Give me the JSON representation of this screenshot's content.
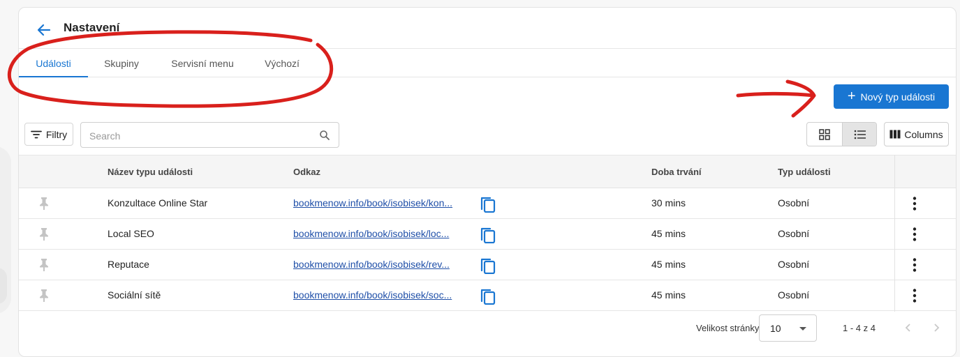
{
  "header": {
    "title": "Nastavení"
  },
  "tabs": [
    {
      "label": "Události",
      "active": true
    },
    {
      "label": "Skupiny",
      "active": false
    },
    {
      "label": "Servisní menu",
      "active": false
    },
    {
      "label": "Výchozí",
      "active": false
    }
  ],
  "toolbar": {
    "new_button": "Nový typ události",
    "filter_button": "Filtry",
    "search_placeholder": "Search",
    "search_value": "",
    "columns_button": "Columns",
    "active_view": "list"
  },
  "table": {
    "columns": [
      "Název typu události",
      "Odkaz",
      "Doba trvání",
      "Typ události"
    ],
    "rows": [
      {
        "name": "Konzultace Online Star",
        "link": "bookmenow.info/book/isobisek/kon...",
        "duration": "30 mins",
        "type": "Osobní"
      },
      {
        "name": "Local SEO",
        "link": "bookmenow.info/book/isobisek/loc...",
        "duration": "45 mins",
        "type": "Osobní"
      },
      {
        "name": "Reputace",
        "link": "bookmenow.info/book/isobisek/rev...",
        "duration": "45 mins",
        "type": "Osobní"
      },
      {
        "name": "Sociální sítě",
        "link": "bookmenow.info/book/isobisek/soc...",
        "duration": "45 mins",
        "type": "Osobní"
      }
    ]
  },
  "pagination": {
    "page_size_label": "Velikost stránky",
    "page_size": "10",
    "range": "1 - 4 z 4"
  },
  "icons": {
    "back": "arrow-left-icon",
    "plus": "plus-icon",
    "filter": "filter-icon",
    "search": "search-icon",
    "grid_view": "grid-view-icon",
    "list_view": "list-view-icon",
    "columns": "columns-icon",
    "pin": "pin-icon",
    "copy": "copy-icon",
    "more": "more-vertical-icon",
    "prev": "chevron-left-icon",
    "next": "chevron-right-icon"
  },
  "colors": {
    "accent": "#1976d2",
    "link": "#1f4fa8",
    "annotation": "#d9201c"
  }
}
